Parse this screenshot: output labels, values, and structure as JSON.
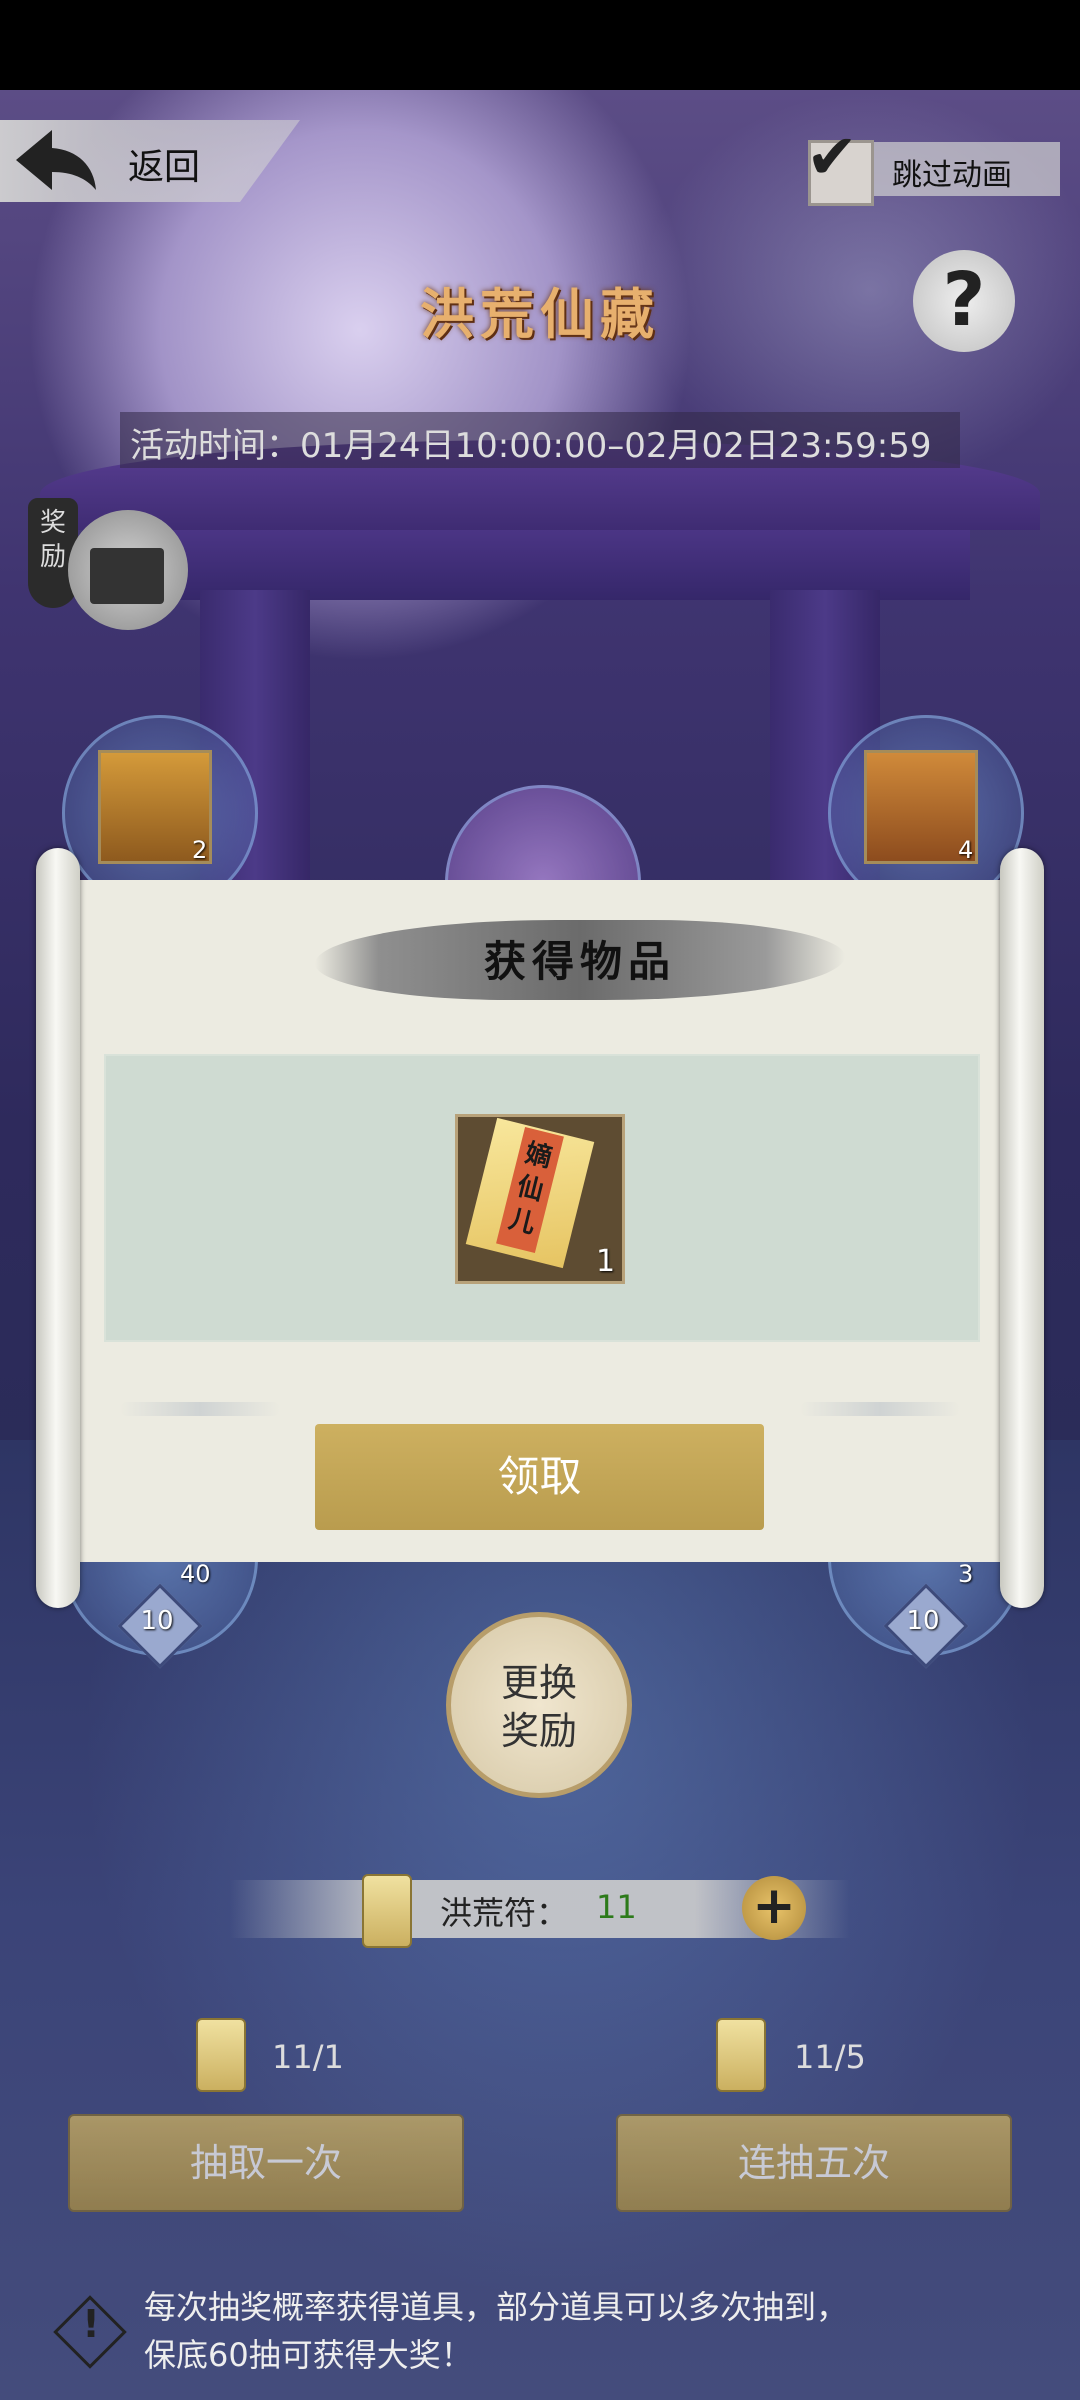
{
  "header": {
    "back_label": "返回",
    "skip_label": "跳过动画",
    "skip_checked": true,
    "help_symbol": "?"
  },
  "event": {
    "title": "洪荒仙藏",
    "time": "活动时间：01月24日10:00:00–02月02日23:59:59"
  },
  "reward_tag": {
    "label": "奖励"
  },
  "slots": {
    "top_left": {
      "icon": "treasure-chest-icon",
      "count": "2"
    },
    "top_right": {
      "icon": "scroll-book-icon",
      "count": "4"
    },
    "bottom_left": {
      "count": "40",
      "tier": "10"
    },
    "bottom_right": {
      "count": "3",
      "tier": "10"
    }
  },
  "modal": {
    "title": "获得物品",
    "item": {
      "icon": "talisman-paper-icon",
      "name": "嫡仙儿",
      "count": "1"
    },
    "claim_label": "领取"
  },
  "change_reward_label": "更换\n奖励",
  "currency": {
    "label": "洪荒符：",
    "value": "11",
    "plus": "+"
  },
  "draw_once": {
    "ratio": "11/1",
    "label": "抽取一次"
  },
  "draw_five": {
    "ratio": "11/5",
    "label": "连抽五次"
  },
  "notice": {
    "line1": "每次抽奖概率获得道具，部分道具可以多次抽到，",
    "line2": "保底60抽可获得大奖！"
  }
}
